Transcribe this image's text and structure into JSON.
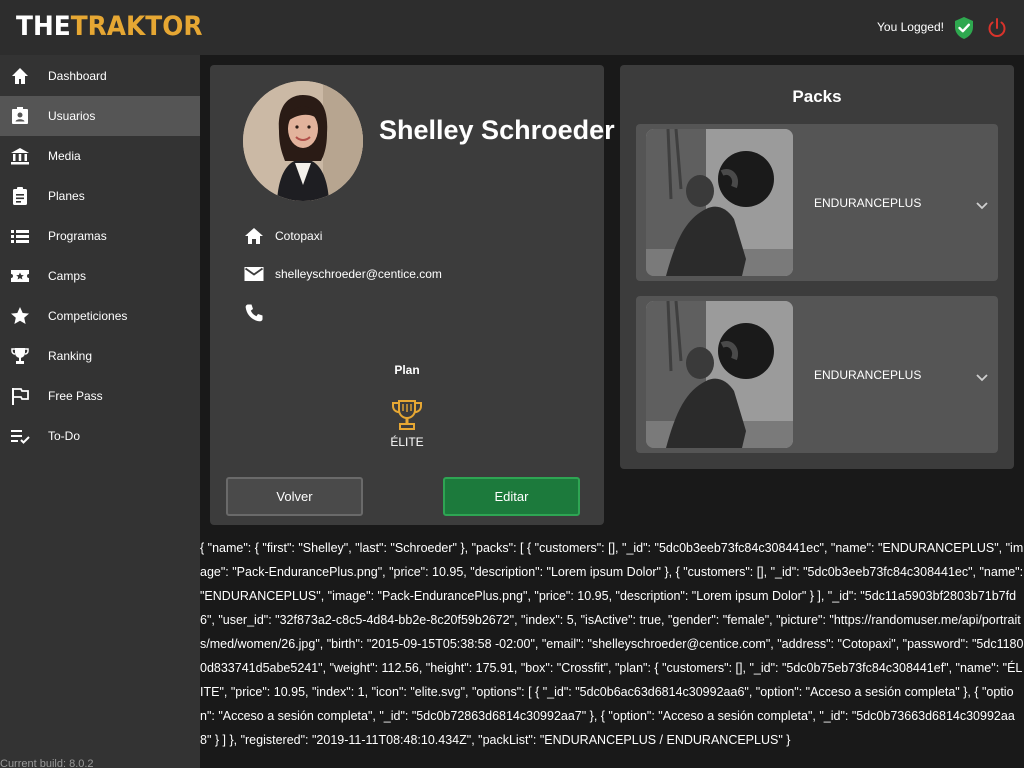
{
  "header": {
    "logo_the": "THE",
    "logo_traktor": "TRAKTOR",
    "status_text": "You Logged!",
    "accent_color": "#e6a733"
  },
  "sidebar": {
    "items": [
      {
        "label": "Dashboard",
        "icon": "home-icon"
      },
      {
        "label": "Usuarios",
        "icon": "user-card-icon"
      },
      {
        "label": "Media",
        "icon": "bank-icon"
      },
      {
        "label": "Planes",
        "icon": "clipboard-icon"
      },
      {
        "label": "Programas",
        "icon": "list-icon"
      },
      {
        "label": "Camps",
        "icon": "ticket-star-icon"
      },
      {
        "label": "Competiciones",
        "icon": "star-icon"
      },
      {
        "label": "Ranking",
        "icon": "trophy-icon"
      },
      {
        "label": "Free Pass",
        "icon": "flag-icon"
      },
      {
        "label": "To-Do",
        "icon": "checklist-icon"
      }
    ],
    "active": "Usuarios",
    "build": "Current build: 8.0.2"
  },
  "profile": {
    "name": "Shelley Schroeder",
    "address": "Cotopaxi",
    "email": "shelleyschroeder@centice.com",
    "phone": "",
    "plan_label": "Plan",
    "plan_name": "ÉLITE",
    "back_label": "Volver",
    "edit_label": "Editar"
  },
  "packs": {
    "title": "Packs",
    "items": [
      {
        "name": "ENDURANCEPLUS"
      },
      {
        "name": "ENDURANCEPLUS"
      }
    ]
  },
  "json_dump": "{ \"name\": { \"first\": \"Shelley\", \"last\": \"Schroeder\" }, \"packs\": [ { \"customers\": [], \"_id\": \"5dc0b3eeb73fc84c308441ec\", \"name\": \"ENDURANCEPLUS\", \"image\": \"Pack-EndurancePlus.png\", \"price\": 10.95, \"description\": \"Lorem ipsum Dolor\" }, { \"customers\": [], \"_id\": \"5dc0b3eeb73fc84c308441ec\", \"name\": \"ENDURANCEPLUS\", \"image\": \"Pack-EndurancePlus.png\", \"price\": 10.95, \"description\": \"Lorem ipsum Dolor\" } ], \"_id\": \"5dc11a5903bf2803b71b7fd6\", \"user_id\": \"32f873a2-c8c5-4d84-bb2e-8c20f59b2672\", \"index\": 5, \"isActive\": true, \"gender\": \"female\", \"picture\": \"https://randomuser.me/api/portraits/med/women/26.jpg\", \"birth\": \"2015-09-15T05:38:58 -02:00\", \"email\": \"shelleyschroeder@centice.com\", \"address\": \"Cotopaxi\", \"password\": \"5dc11800d833741d5abe5241\", \"weight\": 112.56, \"height\": 175.91, \"box\": \"Crossfit\", \"plan\": { \"customers\": [], \"_id\": \"5dc0b75eb73fc84c308441ef\", \"name\": \"ÉLITE\", \"price\": 10.95, \"index\": 1, \"icon\": \"elite.svg\", \"options\": [ { \"_id\": \"5dc0b6ac63d6814c30992aa6\", \"option\": \"Acceso a sesión completa\" }, { \"option\": \"Acceso a sesión completa\", \"_id\": \"5dc0b72863d6814c30992aa7\" }, { \"option\": \"Acceso a sesión completa\", \"_id\": \"5dc0b73663d6814c30992aa8\" } ] }, \"registered\": \"2019-11-11T08:48:10.434Z\", \"packList\": \"ENDURANCEPLUS / ENDURANCEPLUS\" }"
}
